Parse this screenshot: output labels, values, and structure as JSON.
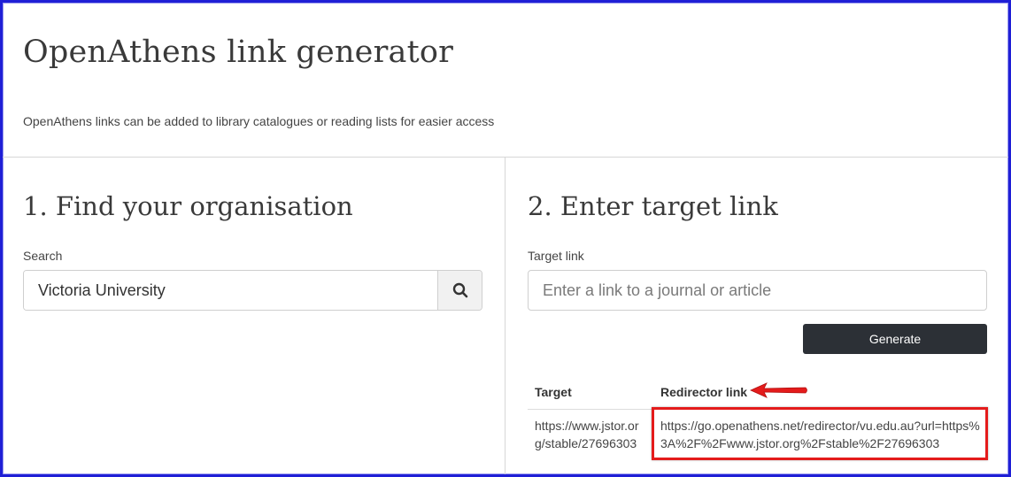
{
  "header": {
    "title": "OpenAthens link generator",
    "subtitle": "OpenAthens links can be added to library catalogues or reading lists for easier access"
  },
  "find_org": {
    "title": "1. Find your organisation",
    "search_label": "Search",
    "search_value": "Victoria University",
    "search_icon": "search-icon"
  },
  "target_link": {
    "title": "2. Enter target link",
    "field_label": "Target link",
    "placeholder": "Enter a link to a journal or article",
    "value": "",
    "generate_label": "Generate"
  },
  "results": {
    "columns": [
      "Target",
      "Redirector link"
    ],
    "rows": [
      {
        "target": "https://www.jstor.org/stable/27696303",
        "redirector": "https://go.openathens.net/redirector/vu.edu.au?url=https%3A%2F%2Fwww.jstor.org%2Fstable%2F27696303"
      }
    ]
  },
  "annotation": {
    "highlight_color": "#e41b1b",
    "frame_color": "#1f1fd6"
  },
  "colors": {
    "button_bg": "#2c3036",
    "divider": "#d6d6d6"
  }
}
